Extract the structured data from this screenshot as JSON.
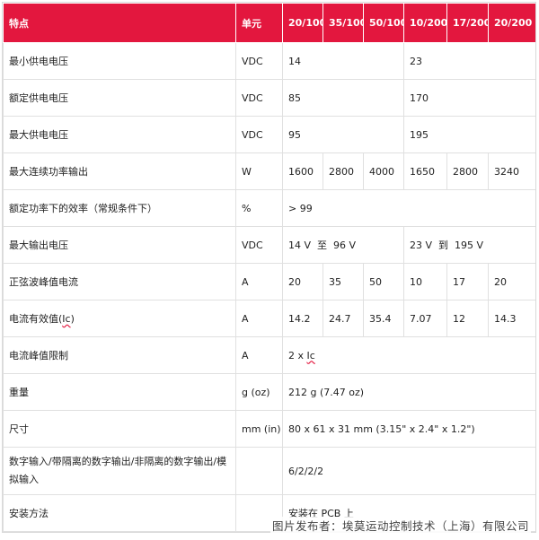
{
  "headers": [
    "特点",
    "单元",
    "20/100",
    "35/100",
    "50/100",
    "10/200",
    "17/200",
    "20/200"
  ],
  "rows": {
    "min_voltage": {
      "label": "最小供电电压",
      "unit": "VDC",
      "v1": "14",
      "v2": "23"
    },
    "rated_voltage": {
      "label": "额定供电电压",
      "unit": "VDC",
      "v1": "85",
      "v2": "170"
    },
    "max_voltage": {
      "label": "最大供电电压",
      "unit": "VDC",
      "v1": "95",
      "v2": "195"
    },
    "cont_power": {
      "label": "最大连续功率输出",
      "unit": "W",
      "values": [
        "1600",
        "2800",
        "4000",
        "1650",
        "2800",
        "3240"
      ]
    },
    "efficiency": {
      "label": "额定功率下的效率（常规条件下）",
      "unit": "%",
      "value": "> 99"
    },
    "max_out_voltage": {
      "label": "最大输出电压",
      "unit": "VDC",
      "v1": "14 V  至  96 V",
      "v2": "23 V  到  195 V"
    },
    "peak_current": {
      "label": "正弦波峰值电流",
      "unit": "A",
      "values": [
        "20",
        "35",
        "50",
        "10",
        "17",
        "20"
      ]
    },
    "rms_current": {
      "label_prefix": "电流有效值(",
      "label_ic": "Ic",
      "label_suffix": ")",
      "unit": "A",
      "values": [
        "14.2",
        "24.7",
        "35.4",
        "7.07",
        "12",
        "14.3"
      ]
    },
    "peak_limit": {
      "label": "电流峰值限制",
      "unit": "A",
      "value_prefix": "2 x ",
      "value_ic": "Ic"
    },
    "weight": {
      "label": "重量",
      "unit": "g (oz)",
      "value": "212 g (7.47 oz)"
    },
    "size": {
      "label": "尺寸",
      "unit": "mm (in)",
      "value": "80 x 61 x 31 mm (3.15\" x 2.4\" x 1.2\")"
    },
    "io": {
      "label": "数字输入/带隔离的数字输出/非隔离的数字输出/模拟输入",
      "unit": "",
      "value": "6/2/2/2"
    },
    "mounting": {
      "label": "安装方法",
      "unit": "",
      "value": "安装在 PCB 上"
    }
  },
  "caption": "图片发布者：埃莫运动控制技术（上海）有限公司",
  "colors": {
    "header_bg": "#e3173e",
    "header_text": "#ffffff",
    "grid": "#e0e0e0"
  }
}
